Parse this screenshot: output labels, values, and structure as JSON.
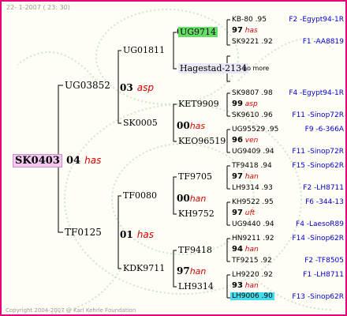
{
  "header": "22- 1-2007 ( 23: 30)",
  "footer": "Copyright 2004-2007 @ Karl Kehrle Foundation",
  "root": {
    "code": "SK0403",
    "year": "04",
    "species": "has"
  },
  "gen1": {
    "top": {
      "code": "UG03852",
      "year": "03",
      "species": "asp"
    },
    "bottom": {
      "code": "TF0125",
      "year": "01",
      "species": "has"
    }
  },
  "gen2": [
    {
      "code": "UG01811",
      "year": "01",
      "species": ""
    },
    {
      "code": "SK0005",
      "year": "00",
      "species": "has"
    },
    {
      "code": "TF0080",
      "year": "00",
      "species": "han"
    },
    {
      "code": "KDK9711",
      "year": "97",
      "species": "han"
    }
  ],
  "gen3": [
    {
      "code": "UG9714",
      "year": "",
      "species": ""
    },
    {
      "code": "Hagestad-2134",
      "year": "",
      "species": ""
    },
    {
      "code": "KET9909",
      "year": "",
      "species": ""
    },
    {
      "code": "KEO96519",
      "year": "",
      "species": ""
    },
    {
      "code": "TF9705",
      "year": "",
      "species": ""
    },
    {
      "code": "KH9752",
      "year": "",
      "species": ""
    },
    {
      "code": "TF9418",
      "year": "",
      "species": ""
    },
    {
      "code": "LH9314",
      "year": "",
      "species": ""
    }
  ],
  "gen4": [
    {
      "top": "KB-80 .95",
      "year": "97",
      "species": "has",
      "bottom": "SK9221 .92",
      "right_top": "F2 -Egypt94-1R",
      "right_bottom": "F1 -AA8819"
    },
    {
      "top": "",
      "year": "",
      "species": "",
      "bottom": "",
      "note": "no more",
      "right_top": "",
      "right_bottom": ""
    },
    {
      "top": "SK9807 .98",
      "year": "99",
      "species": "asp",
      "bottom": "SK9610 .96",
      "right_top": "F4 -Egypt94-1R",
      "right_bottom": "F11 -Sinop72R"
    },
    {
      "top": "UG95529 .95",
      "year": "96",
      "species": "ven",
      "bottom": "UG9409 .94",
      "right_top": "F9 -6-366A",
      "right_bottom": "F11 -Sinop72R"
    },
    {
      "top": "TF9418 .94",
      "year": "97",
      "species": "han",
      "bottom": "LH9314 .93",
      "right_top": "F15 -Sinop62R",
      "right_bottom": "F2 -LH8711"
    },
    {
      "top": "KH9522 .95",
      "year": "97",
      "species": "uft",
      "bottom": "UG9440 .94",
      "right_top": "F6 -344-13",
      "right_bottom": "F4 -LaesoR89"
    },
    {
      "top": "HN9211 .92",
      "year": "94",
      "species": "han",
      "bottom": "TF9215 .92",
      "right_top": "F14 -Sinop62R",
      "right_bottom": "F2 -TF8505"
    },
    {
      "top": "LH9220 .92",
      "year": "93",
      "species": "han",
      "bottom": "LH9006 .90",
      "right_top": "F1 -LH8711",
      "right_bottom": "F13 -Sinop62R"
    }
  ],
  "colors": {
    "border": "#e6007e",
    "root_bg": "#f4c8f0",
    "ug9714_bg": "#66dd66",
    "hagestad_bg": "#e8e8f6",
    "lh9006_bg": "#44ddee",
    "right_text": "#0000cc",
    "species": "#d40000"
  }
}
